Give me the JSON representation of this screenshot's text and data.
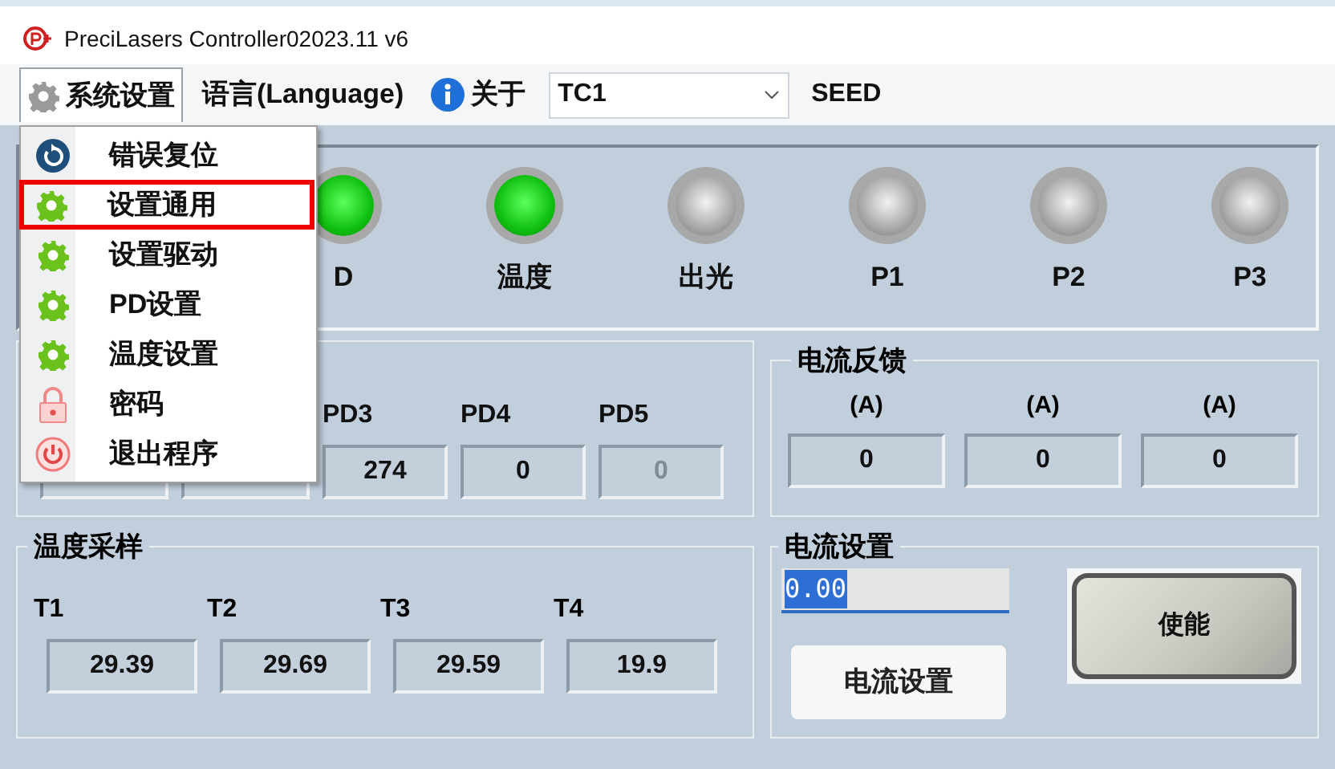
{
  "window": {
    "title": "PreciLasers Controller02023.11 v6"
  },
  "menu_bar": [
    {
      "label": "系统设置",
      "kind": "gear",
      "expanded": true
    },
    {
      "label": "语言(Language)",
      "kind": "plain",
      "expanded": false
    },
    {
      "label": "关于",
      "kind": "info",
      "expanded": false
    }
  ],
  "channel_select": {
    "value": "TC1"
  },
  "mode_label": "SEED",
  "indicators": [
    {
      "label": "D",
      "on": true
    },
    {
      "label": "温度",
      "on": true
    },
    {
      "label": "出光",
      "on": false
    },
    {
      "label": "P1",
      "on": false
    },
    {
      "label": "P2",
      "on": false
    },
    {
      "label": "P3",
      "on": false
    }
  ],
  "pd_readings": [
    {
      "label": "PD3",
      "value": "274",
      "disabled": false
    },
    {
      "label": "PD4",
      "value": "0",
      "disabled": false
    },
    {
      "label": "PD5",
      "value": "0",
      "disabled": true
    }
  ],
  "current_feedback": {
    "title": "电流反馈",
    "readings": [
      {
        "unit": "(A)",
        "value": "0"
      },
      {
        "unit": "(A)",
        "value": "0"
      },
      {
        "unit": "(A)",
        "value": "0"
      }
    ]
  },
  "temperature": {
    "title": "温度采样",
    "readings": [
      {
        "label": "T1",
        "value": "29.39"
      },
      {
        "label": "T2",
        "value": "29.69"
      },
      {
        "label": "T3",
        "value": "29.59"
      },
      {
        "label": "T4",
        "value": "19.9"
      }
    ]
  },
  "current_setting": {
    "title": "电流设置",
    "value": "0.00",
    "text_selected": true,
    "set_button": "电流设置",
    "enable_button": "使能"
  },
  "system_menu": [
    {
      "label": "错误复位",
      "kind": "reset",
      "selected": false
    },
    {
      "label": "设置通用",
      "kind": "gear",
      "selected": true
    },
    {
      "label": "设置驱动",
      "kind": "gear",
      "selected": false
    },
    {
      "label": "PD设置",
      "kind": "gear",
      "selected": false
    },
    {
      "label": "温度设置",
      "kind": "gear",
      "selected": false
    },
    {
      "label": "密码",
      "kind": "lock",
      "selected": false
    },
    {
      "label": "退出程序",
      "kind": "power",
      "selected": false
    }
  ]
}
